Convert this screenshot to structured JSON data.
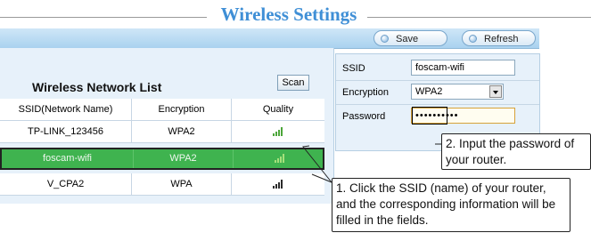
{
  "title": "Wireless Settings",
  "toolbar": {
    "save_label": "Save",
    "refresh_label": "Refresh"
  },
  "network_list": {
    "title": "Wireless Network List",
    "scan_label": "Scan",
    "columns": [
      "SSID(Network Name)",
      "Encryption",
      "Quality"
    ],
    "rows": [
      {
        "ssid": "TP-LINK_123456",
        "encryption": "WPA2",
        "quality_icon": "signal-strength-icon-green"
      },
      {
        "ssid": "foscam-wifi",
        "encryption": "WPA2",
        "quality_icon": "signal-strength-icon-green",
        "selected": true
      },
      {
        "ssid": "V_CPA2",
        "encryption": "WPA",
        "quality_icon": "signal-strength-icon-dark"
      }
    ]
  },
  "settings": {
    "ssid_label": "SSID",
    "ssid_value": "foscam-wifi",
    "encryption_label": "Encryption",
    "encryption_value": "WPA2",
    "password_label": "Password",
    "password_value": "••••••••••"
  },
  "callouts": {
    "step2": "2. Input the password of your router.",
    "step1": "1. Click the SSID (name) of your router, and the corresponding information will be filled in the fields."
  },
  "colors": {
    "title": "#3f8fd6",
    "selected_row": "#3fb34f",
    "panel_bg": "#e7f1fa"
  }
}
